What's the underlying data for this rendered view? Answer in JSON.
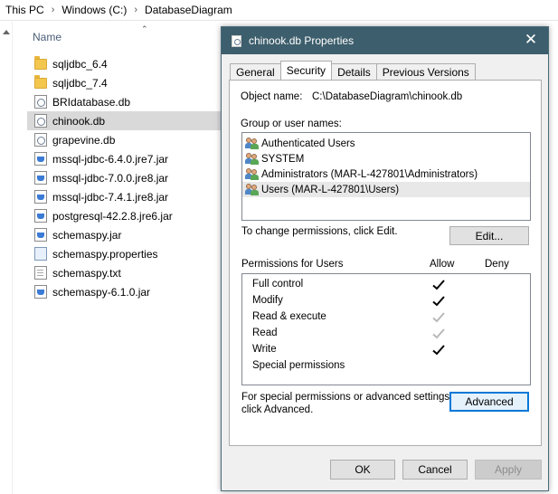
{
  "explorer": {
    "breadcrumb": [
      "This PC",
      "Windows (C:)",
      "DatabaseDiagram"
    ],
    "column_name": "Name",
    "files": [
      {
        "name": "sqljdbc_6.4",
        "icon": "folder-icon",
        "selected": false
      },
      {
        "name": "sqljdbc_7.4",
        "icon": "folder-icon",
        "selected": false
      },
      {
        "name": "BRIdatabase.db",
        "icon": "database-file-icon",
        "selected": false
      },
      {
        "name": "chinook.db",
        "icon": "database-file-icon",
        "selected": true
      },
      {
        "name": "grapevine.db",
        "icon": "database-file-icon",
        "selected": false
      },
      {
        "name": "mssql-jdbc-6.4.0.jre7.jar",
        "icon": "jar-file-icon",
        "selected": false
      },
      {
        "name": "mssql-jdbc-7.0.0.jre8.jar",
        "icon": "jar-file-icon",
        "selected": false
      },
      {
        "name": "mssql-jdbc-7.4.1.jre8.jar",
        "icon": "jar-file-icon",
        "selected": false
      },
      {
        "name": "postgresql-42.2.8.jre6.jar",
        "icon": "jar-file-icon",
        "selected": false
      },
      {
        "name": "schemaspy.jar",
        "icon": "jar-file-icon",
        "selected": false
      },
      {
        "name": "schemaspy.properties",
        "icon": "properties-file-icon",
        "selected": false
      },
      {
        "name": "schemaspy.txt",
        "icon": "text-file-icon",
        "selected": false
      },
      {
        "name": "schemaspy-6.1.0.jar",
        "icon": "jar-file-icon",
        "selected": false
      }
    ]
  },
  "dialog": {
    "title": "chinook.db Properties",
    "titlebar_color": "#3d5e6c",
    "tabs": [
      {
        "label": "General",
        "active": false
      },
      {
        "label": "Security",
        "active": true
      },
      {
        "label": "Details",
        "active": false
      },
      {
        "label": "Previous Versions",
        "active": false
      }
    ],
    "object_name_label": "Object name:",
    "object_name_value": "C:\\DatabaseDiagram\\chinook.db",
    "group_label": "Group or user names:",
    "users": [
      {
        "name": "Authenticated Users",
        "selected": false
      },
      {
        "name": "SYSTEM",
        "selected": false
      },
      {
        "name": "Administrators (MAR-L-427801\\Administrators)",
        "selected": false
      },
      {
        "name": "Users (MAR-L-427801\\Users)",
        "selected": true
      }
    ],
    "change_text": "To change permissions, click Edit.",
    "edit_button": "Edit...",
    "permissions_label": "Permissions for Users",
    "allow_header": "Allow",
    "deny_header": "Deny",
    "permissions": [
      {
        "name": "Full control",
        "allow": "checked"
      },
      {
        "name": "Modify",
        "allow": "checked"
      },
      {
        "name": "Read & execute",
        "allow": "inherited"
      },
      {
        "name": "Read",
        "allow": "inherited"
      },
      {
        "name": "Write",
        "allow": "checked"
      },
      {
        "name": "Special permissions",
        "allow": "none"
      }
    ],
    "special_text_1": "For special permissions or advanced settings,",
    "special_text_2": "click Advanced.",
    "advanced_button": "Advanced",
    "ok_button": "OK",
    "cancel_button": "Cancel",
    "apply_button": "Apply"
  }
}
